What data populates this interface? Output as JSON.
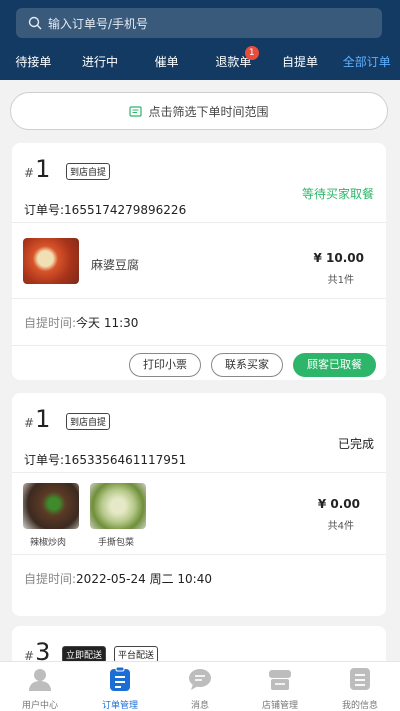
{
  "search": {
    "placeholder": "输入订单号/手机号"
  },
  "tabs": [
    {
      "label": "待接单"
    },
    {
      "label": "进行中"
    },
    {
      "label": "催单"
    },
    {
      "label": "退款单",
      "badge": "1"
    },
    {
      "label": "自提单"
    },
    {
      "label": "全部订单",
      "active": true
    }
  ],
  "filter": {
    "label": "点击筛选下单时间范围"
  },
  "orders": [
    {
      "num_prefix": "#",
      "num": "1",
      "tag": "到店自提",
      "status": "等待买家取餐",
      "order_no": "订单号:1655174279896226",
      "goods_name": "麻婆豆腐",
      "price": "¥ 10.00",
      "qty": "共1件",
      "pickup_label": "自提时间:",
      "pickup_time": "今天 11:30",
      "buttons": [
        "打印小票",
        "联系买家",
        "顾客已取餐"
      ]
    },
    {
      "num_prefix": "#",
      "num": "1",
      "tag": "到店自提",
      "status": "已完成",
      "order_no": "订单号:1653356461117951",
      "goods": [
        {
          "name": "辣椒炒肉"
        },
        {
          "name": "手撕包菜"
        }
      ],
      "price": "¥ 0.00",
      "qty": "共4件",
      "pickup_label": "自提时间:",
      "pickup_time": "2022-05-24 周二 10:40"
    },
    {
      "num_prefix": "#",
      "num": "3",
      "tags": [
        "立即配送",
        "平台配送"
      ]
    }
  ],
  "bottom_nav": [
    {
      "label": "用户中心",
      "icon": "user-icon"
    },
    {
      "label": "订单管理",
      "icon": "clipboard-icon",
      "active": true
    },
    {
      "label": "消息",
      "icon": "chat-icon"
    },
    {
      "label": "店铺管理",
      "icon": "store-icon"
    },
    {
      "label": "我的信息",
      "icon": "list-icon"
    }
  ],
  "colors": {
    "header": "#123a63",
    "accent": "#1b6fd4",
    "green": "#2db56a"
  }
}
